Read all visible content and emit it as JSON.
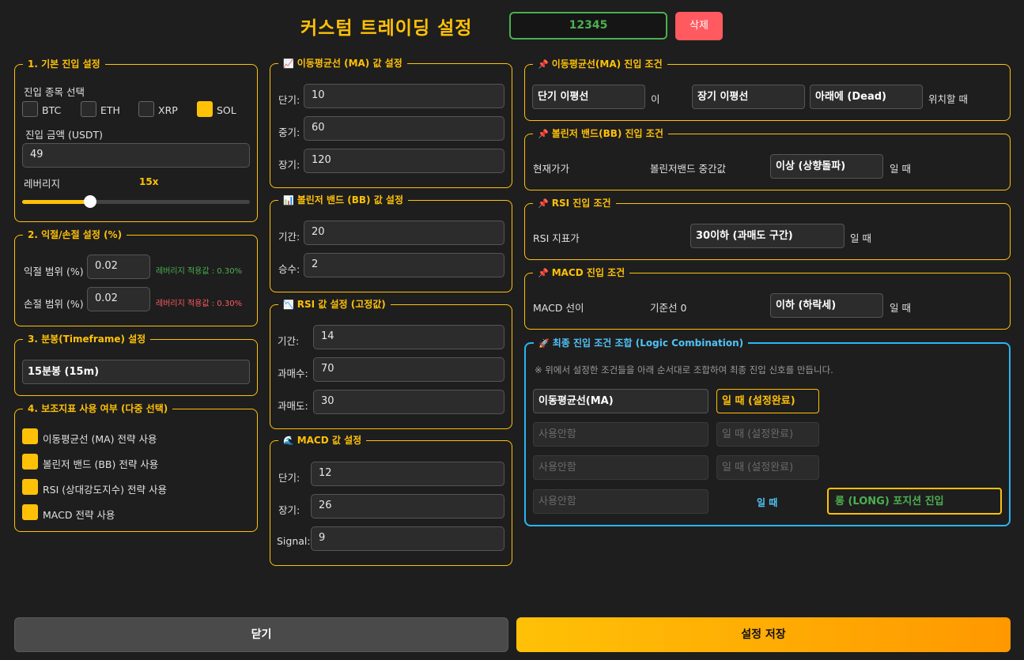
{
  "header": {
    "title": "커스텀 트레이딩 설정",
    "id_value": "12345",
    "delete_label": "삭제"
  },
  "colors": {
    "accent": "#ffc107",
    "green": "#4caf50",
    "red": "#ff5a5f",
    "cyan": "#29b6f6"
  },
  "basic": {
    "legend": "1. 기본 진입 설정",
    "coin_label": "진입 종목 선택",
    "coins": [
      {
        "label": "BTC",
        "checked": false
      },
      {
        "label": "ETH",
        "checked": false
      },
      {
        "label": "XRP",
        "checked": false
      },
      {
        "label": "SOL",
        "checked": true
      }
    ],
    "amount_label": "진입 금액 (USDT)",
    "amount_value": "49",
    "leverage_label": "레버리지",
    "leverage_value": "15x",
    "leverage_fraction": 0.3
  },
  "tpsl": {
    "legend": "2. 익절/손절 설정 (%)",
    "tp_label": "익절 범위 (%)",
    "tp_value": "0.02",
    "tp_note": "레버리지 적용값 : 0.30%",
    "sl_label": "손절 범위 (%)",
    "sl_value": "0.02",
    "sl_note": "레버리지 적용값 : 0.30%"
  },
  "timeframe": {
    "legend": "3. 분봉(Timeframe) 설정",
    "value": "15분봉 (15m)"
  },
  "indicators": {
    "legend": "4. 보조지표 사용 여부 (다중 선택)",
    "items": [
      {
        "label": "이동평균선 (MA) 전략 사용",
        "checked": true
      },
      {
        "label": "볼린저 밴드 (BB) 전략 사용",
        "checked": true
      },
      {
        "label": "RSI (상대강도지수) 전략 사용",
        "checked": true
      },
      {
        "label": "MACD 전략 사용",
        "checked": true
      }
    ]
  },
  "ma_settings": {
    "legend": "이동평균선 (MA) 값 설정",
    "icon": "📈",
    "short_label": "단기:",
    "short": "10",
    "mid_label": "중기:",
    "mid": "60",
    "long_label": "장기:",
    "long": "120"
  },
  "bb_settings": {
    "legend": "볼린저 밴드 (BB) 값 설정",
    "icon": "📊",
    "period_label": "기간:",
    "period": "20",
    "mult_label": "승수:",
    "mult": "2"
  },
  "rsi_settings": {
    "legend": "RSI 값 설정 (고정값)",
    "icon": "📉",
    "period_label": "기간:",
    "period": "14",
    "ob_label": "과매수:",
    "ob": "70",
    "os_label": "과매도:",
    "os": "30"
  },
  "macd_settings": {
    "legend": "MACD 값 설정",
    "icon": "🌊",
    "short_label": "단기:",
    "short": "12",
    "long_label": "장기:",
    "long": "26",
    "signal_label": "Signal:",
    "signal": "9"
  },
  "ma_cond": {
    "legend": "이동평균선(MA) 진입 조건",
    "icon": "📌",
    "a": "단기 이평선",
    "mid": "이",
    "b": "장기 이평선",
    "c": "아래에 (Dead)",
    "tail": "위치할 때"
  },
  "bb_cond": {
    "legend": "볼린저 밴드(BB) 진입 조건",
    "icon": "📌",
    "a": "현재가가",
    "b": "볼린저밴드 중간값",
    "c": "이상 (상향돌파)",
    "tail": "일 때"
  },
  "rsi_cond": {
    "legend": "RSI 진입 조건",
    "icon": "📌",
    "a": "RSI 지표가",
    "c": "30이하 (과매도 구간)",
    "tail": "일 때"
  },
  "macd_cond": {
    "legend": "MACD 진입 조건",
    "icon": "📌",
    "a": "MACD 선이",
    "b": "기준선 0",
    "c": "이하 (하락세)",
    "tail": "일 때"
  },
  "logic": {
    "legend": "최종 진입 조건 조합 (Logic Combination)",
    "icon": "🚀",
    "note": "※ 위에서 설정한 조건들을 아래 순서대로 조합하여 최종 진입 신호를 만듭니다.",
    "row1_sel": "이동평균선(MA)",
    "row1_when": "일 때 (설정완료)",
    "row2_sel": "사용안함",
    "row2_when": "일 때 (설정완료)",
    "row3_sel": "사용안함",
    "row3_when": "일 때 (설정완료)",
    "row4_sel": "사용안함",
    "row4_when": "일 때",
    "position": "롱 (LONG) 포지션 진입"
  },
  "footer": {
    "close_label": "닫기",
    "save_label": "설정 저장"
  }
}
